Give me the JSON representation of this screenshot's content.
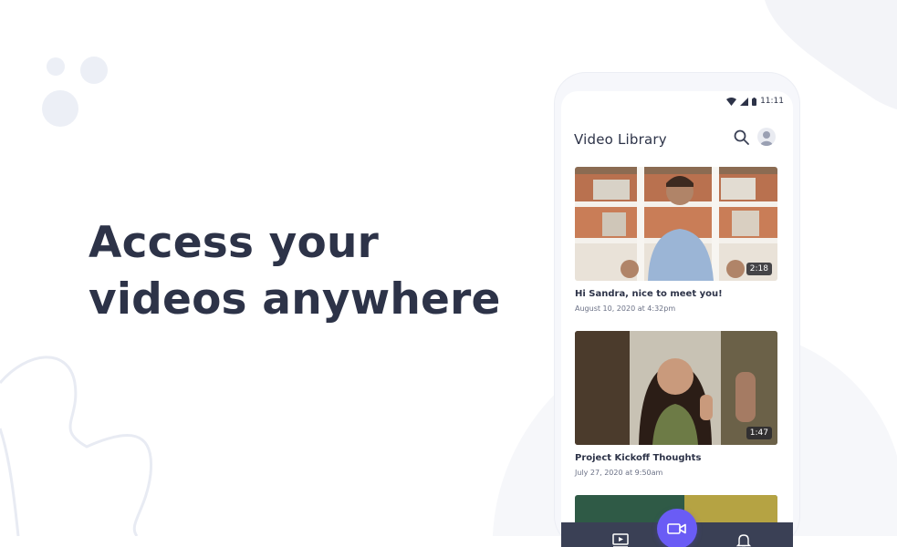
{
  "hero": {
    "line1": "Access your",
    "line2": "videos anywhere"
  },
  "status_bar": {
    "time": "11:11"
  },
  "app": {
    "title": "Video Library",
    "videos": [
      {
        "title": "Hi Sandra, nice to meet you!",
        "date": "August 10, 2020 at 4:32pm",
        "duration": "2:18"
      },
      {
        "title": "Project Kickoff Thoughts",
        "date": "July 27, 2020 at 9:50am",
        "duration": "1:47"
      }
    ]
  },
  "icons": {
    "search": "search-icon",
    "profile": "avatar",
    "library": "video-library-icon",
    "record": "video-camera-icon",
    "notifications": "bell-icon"
  },
  "colors": {
    "text_dark": "#2d3348",
    "accent": "#6a5cf5",
    "nav_bg": "#3a4055",
    "decor": "#eef0f6"
  }
}
